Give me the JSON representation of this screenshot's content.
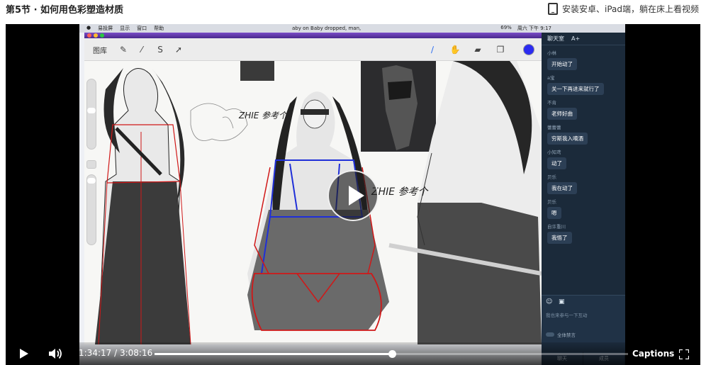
{
  "header": {
    "title": "第5节 · 如何用色彩塑造材质",
    "install_text": "安装安卓、iPad端，躺在床上看视频",
    "icon": "tablet-icon"
  },
  "mac_menubar": {
    "menus": [
      "易投屏",
      "显示",
      "窗口",
      "帮助"
    ],
    "now_playing": "aby on Baby dropped, man,",
    "battery": "69%",
    "clock": "周六 下午 9:17"
  },
  "procreate": {
    "gallery_label": "图库",
    "accent_color": "#2b2bf0",
    "annotations": [
      "ZHIE 参考个",
      "ZHIE 参考个"
    ]
  },
  "chat": {
    "title": "聊天室",
    "font_label": "A+",
    "messages": [
      {
        "name": "小林",
        "text": "开始动了"
      },
      {
        "name": "a宝",
        "text": "关一下再进来就行了"
      },
      {
        "name": "不肯",
        "text": "老师好曲"
      },
      {
        "name": "蕾蕾蕾",
        "text": "穷斯我入嘀酒"
      },
      {
        "name": "小知鸢",
        "text": "动了"
      },
      {
        "name": "贝乐",
        "text": "我在动了"
      },
      {
        "name": "贝乐",
        "text": "嗯"
      },
      {
        "name": "自许重川",
        "text": "我悟了"
      }
    ],
    "input_placeholder": "我也来参与一下互动",
    "mute_label": "全体禁言",
    "buttons": [
      "聊天",
      "成员"
    ]
  },
  "player": {
    "current_time": "1:34:17",
    "separator": "/",
    "duration": "3:08:16",
    "progress_fraction": 0.501,
    "captions_label": "Captions"
  }
}
